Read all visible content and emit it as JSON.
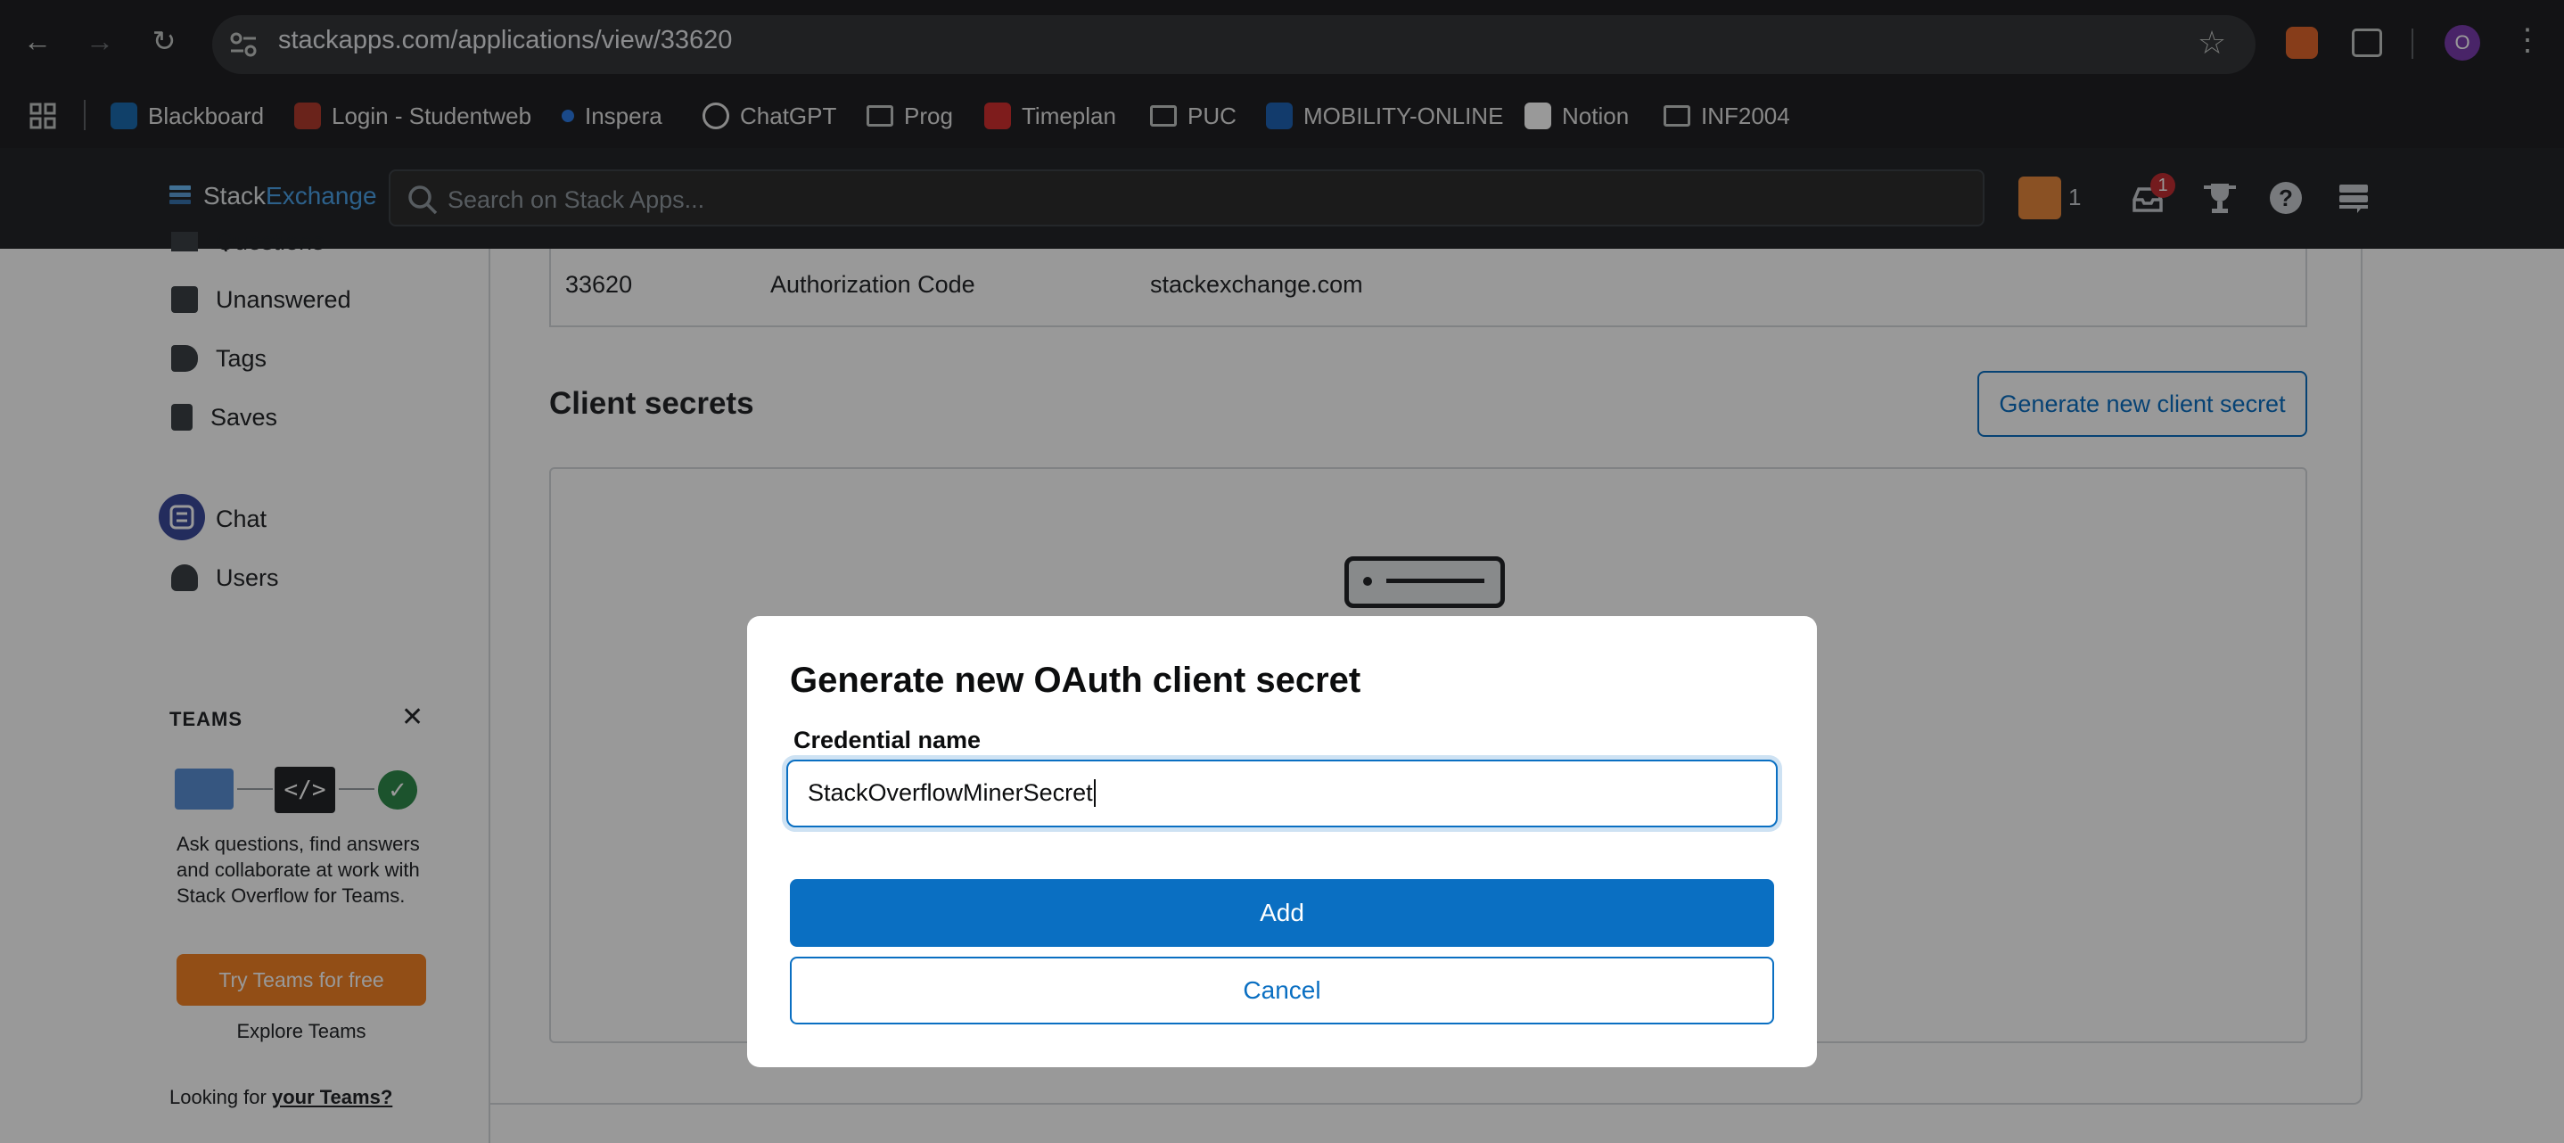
{
  "browser": {
    "url": "stackapps.com/applications/view/33620",
    "bookmarks": [
      {
        "label": "Blackboard",
        "icon": "blackboard-icon"
      },
      {
        "label": "Login - Studentweb",
        "icon": "studentweb-icon"
      },
      {
        "label": "Inspera",
        "icon": "inspera-icon"
      },
      {
        "label": "ChatGPT",
        "icon": "chatgpt-icon"
      },
      {
        "label": "Prog",
        "icon": "folder-icon"
      },
      {
        "label": "Timeplan",
        "icon": "timeplan-icon"
      },
      {
        "label": "PUC",
        "icon": "folder-icon"
      },
      {
        "label": "MOBILITY-ONLINE",
        "icon": "mobility-icon"
      },
      {
        "label": "Notion",
        "icon": "notion-icon"
      },
      {
        "label": "INF2004",
        "icon": "folder-icon"
      }
    ],
    "profile_initial": "O"
  },
  "topbar": {
    "logo_part1": "Stack",
    "logo_part2": "Exchange",
    "search_placeholder": "Search on Stack Apps...",
    "reputation": "1",
    "inbox_count": "1"
  },
  "sidebar": {
    "partial_item": "Questions",
    "items": [
      "Unanswered",
      "Tags",
      "Saves",
      "Chat",
      "Users"
    ],
    "teams": {
      "heading": "TEAMS",
      "description": "Ask questions, find answers and collaborate at work with Stack Overflow for Teams.",
      "try_button": "Try Teams for free",
      "explore_link": "Explore Teams",
      "looking_prefix": "Looking for ",
      "looking_link": "your Teams?"
    }
  },
  "main": {
    "table_row": [
      "33620",
      "Authorization Code",
      "stackexchange.com"
    ],
    "section_title": "Client secrets",
    "generate_button": "Generate new client secret"
  },
  "modal": {
    "title": "Generate new OAuth client secret",
    "field_label": "Credential name",
    "field_value": "StackOverflowMinerSecret",
    "add_button": "Add",
    "cancel_button": "Cancel"
  },
  "colors": {
    "accent": "#0a6fc2",
    "teams_orange": "#f48225",
    "notification_red": "#c22e32",
    "avatar_purple": "#7a3dad"
  }
}
